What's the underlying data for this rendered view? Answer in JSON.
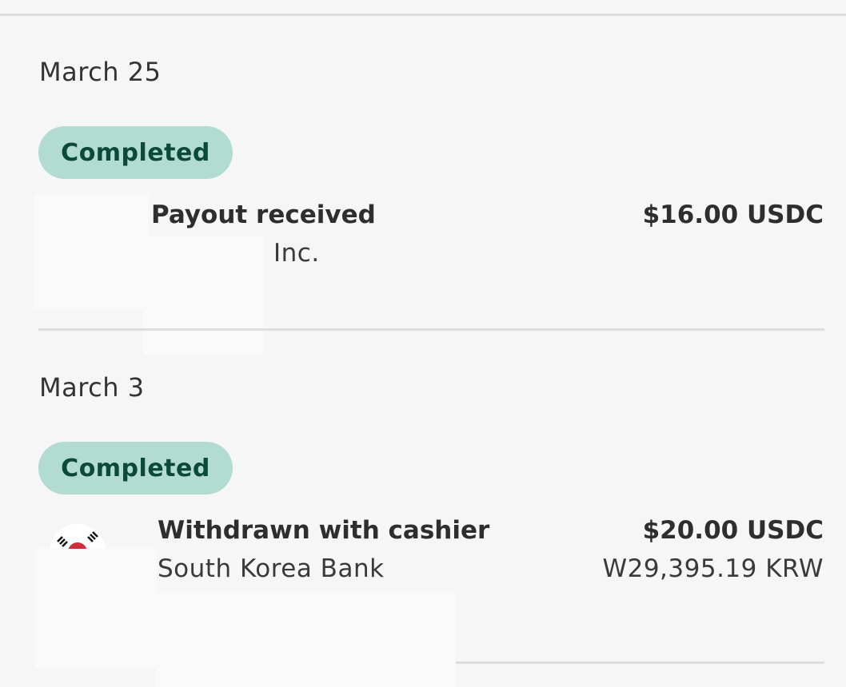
{
  "transactions": [
    {
      "date": "March 25",
      "status": "Completed",
      "title": "Payout received",
      "subtitle": "Inc.",
      "amount": "$16.00 USDC",
      "sub_amount": ""
    },
    {
      "date": "March 3",
      "status": "Completed",
      "title": "Withdrawn with cashier",
      "subtitle": "South Korea Bank",
      "amount": "$20.00 USDC",
      "sub_amount": "W29,395.19 KRW",
      "icon": "south-korea-flag-icon"
    }
  ],
  "colors": {
    "status_bg": "#b2dbd2",
    "status_text": "#0a4a36",
    "background": "#f6f6f6"
  }
}
